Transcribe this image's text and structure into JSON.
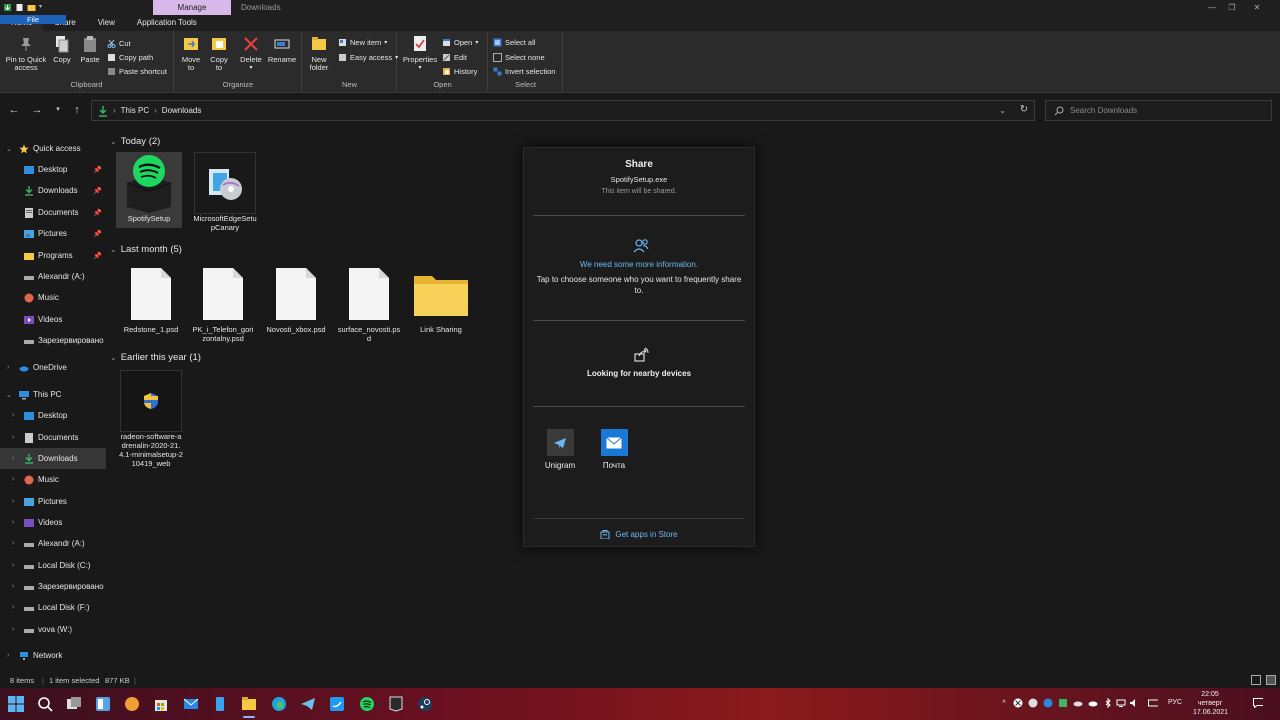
{
  "titlebar": {
    "contextual_tab": "Manage",
    "window_title": "Downloads",
    "minimize": "—",
    "maximize": "❐",
    "close": "✕"
  },
  "ribbon_tabs": {
    "file": "File",
    "home": "Home",
    "share": "Share",
    "view": "View",
    "app_tools": "Application Tools"
  },
  "ribbon": {
    "clipboard": {
      "label": "Clipboard",
      "pin_l1": "Pin to Quick",
      "pin_l2": "access",
      "copy": "Copy",
      "paste": "Paste",
      "cut": "Cut",
      "copy_path": "Copy path",
      "paste_shortcut": "Paste shortcut"
    },
    "organize": {
      "label": "Organize",
      "move_l1": "Move",
      "move_l2": "to",
      "copy_l1": "Copy",
      "copy_l2": "to",
      "delete": "Delete",
      "rename": "Rename"
    },
    "new": {
      "label": "New",
      "folder_l1": "New",
      "folder_l2": "folder",
      "new_item": "New item",
      "easy_access": "Easy access"
    },
    "open": {
      "label": "Open",
      "properties": "Properties",
      "open": "Open",
      "edit": "Edit",
      "history": "History"
    },
    "select": {
      "label": "Select",
      "select_all": "Select all",
      "select_none": "Select none",
      "invert": "Invert selection"
    }
  },
  "address": {
    "this_pc": "This PC",
    "downloads": "Downloads",
    "search_placeholder": "Search Downloads"
  },
  "nav": {
    "quick_access": "Quick access",
    "qa_items": [
      "Desktop",
      "Downloads",
      "Documents",
      "Pictures",
      "Programs",
      "Alexandr (A:)",
      "Music",
      "Videos",
      "Зарезервировано"
    ],
    "onedrive": "OneDrive",
    "this_pc": "This PC",
    "pc_items": [
      "Desktop",
      "Documents",
      "Downloads",
      "Music",
      "Pictures",
      "Videos",
      "Alexandr (A:)",
      "Local Disk (C:)",
      "Зарезервировано",
      "Local Disk (F:)",
      "vova (W:)"
    ],
    "network": "Network"
  },
  "groups": {
    "today": "Today (2)",
    "last_month": "Last month (5)",
    "earlier": "Earlier this year (1)"
  },
  "files": {
    "today": [
      "SpotifySetup",
      "MicrosoftEdgeSetupCanary"
    ],
    "last_month": [
      "Redstone_1.psd",
      "PK_i_Telefon_gorizontalny.psd",
      "Novosti_xbox.psd",
      "surface_novosti.psd",
      "Link Sharing"
    ],
    "earlier": [
      "radeon-software-adrenalin-2020-21.4.1-minimalsetup-210419_web"
    ]
  },
  "share": {
    "title": "Share",
    "filename": "SpotifySetup.exe",
    "subtitle": "This item will be shared.",
    "info_title": "We need some more information.",
    "info_body": "Tap to choose someone who you want to frequently share to.",
    "nearby": "Looking for nearby devices",
    "apps": [
      "Unigram",
      "Почта"
    ],
    "store": "Get apps in Store"
  },
  "status": {
    "items": "8 items",
    "selected": "1 item selected",
    "size": "877 KB"
  },
  "taskbar": {
    "lang": "РУС",
    "time": "22:05",
    "day": "четверг",
    "date": "17.06.2021"
  },
  "colors": {
    "accent": "#1c62b9",
    "link": "#6cb8f2",
    "manage_tab": "#d8b8e8"
  }
}
